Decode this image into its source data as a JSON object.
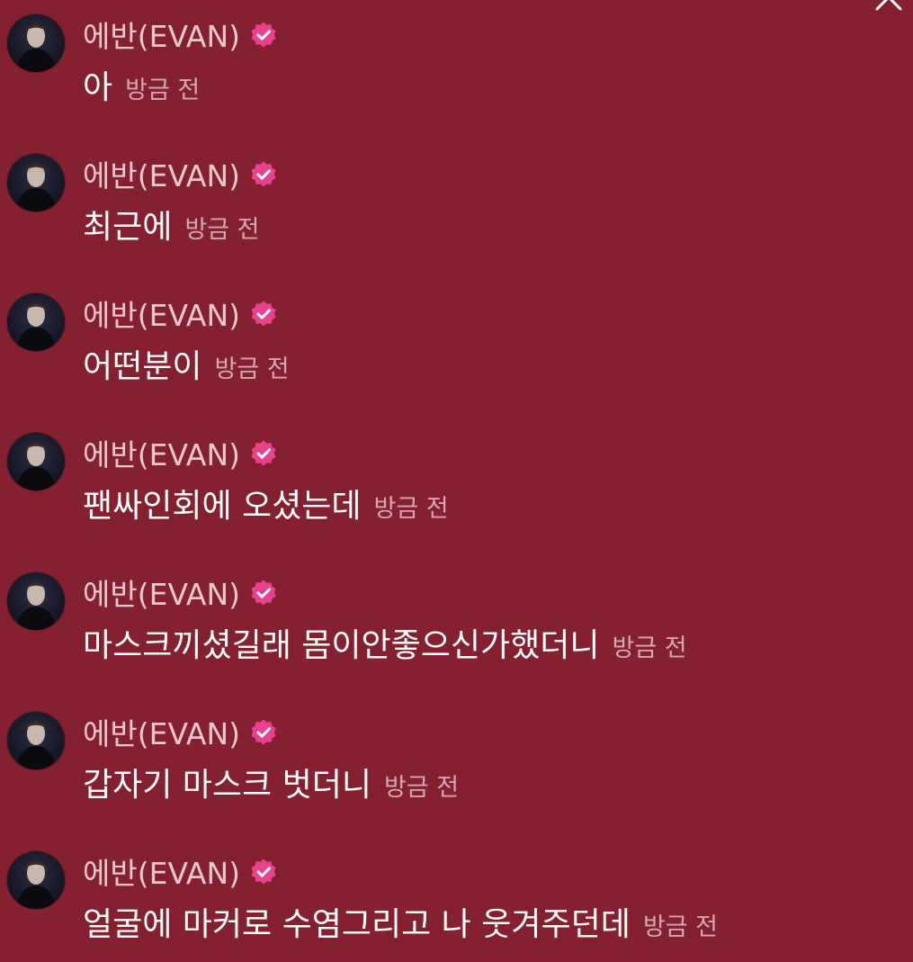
{
  "theme": {
    "background": "#84202f",
    "username_color": "#e8c7cd",
    "timestamp_color": "#d7a7b1",
    "verified_color": "#e9418f"
  },
  "sender": {
    "name": "에반(EVAN)",
    "verified_icon": "verified-badge-icon",
    "avatar": "profile-avatar"
  },
  "messages": [
    {
      "text": "아",
      "time": "방금 전"
    },
    {
      "text": "최근에",
      "time": "방금 전"
    },
    {
      "text": "어떤분이",
      "time": "방금 전"
    },
    {
      "text": "팬싸인회에 오셨는데",
      "time": "방금 전"
    },
    {
      "text": "마스크끼셨길래 몸이안좋으신가했더니",
      "time": "방금 전"
    },
    {
      "text": "갑자기 마스크 벗더니",
      "time": "방금 전"
    },
    {
      "text": "얼굴에 마커로 수염그리고 나 웃겨주던데",
      "time": "방금 전"
    }
  ]
}
